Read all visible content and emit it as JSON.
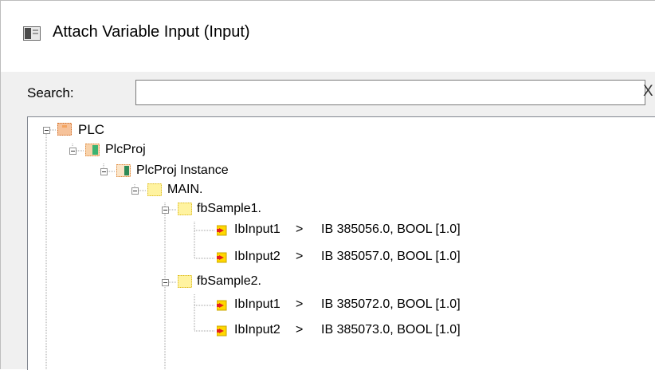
{
  "window": {
    "title": "Attach Variable Input (Input)",
    "icon": "window-app-icon"
  },
  "search": {
    "label": "Search:",
    "value": "",
    "clear_label": "X"
  },
  "tree": {
    "nodes": [
      {
        "label": "PLC",
        "icon": "plc-icon",
        "expanded": true
      },
      {
        "label": "PlcProj",
        "icon": "plc-project-icon",
        "expanded": true
      },
      {
        "label": "PlcProj Instance",
        "icon": "plc-instance-icon",
        "expanded": true
      },
      {
        "label": "MAIN.",
        "icon": "folder-icon",
        "expanded": true
      },
      {
        "label": "fbSample1.",
        "icon": "folder-icon",
        "expanded": true
      },
      {
        "label": "IbInput1",
        "link": ">",
        "address": "IB 385056.0, BOOL [1.0]",
        "icon": "input-variable-icon"
      },
      {
        "label": "IbInput2",
        "link": ">",
        "address": "IB 385057.0, BOOL [1.0]",
        "icon": "input-variable-icon"
      },
      {
        "label": "fbSample2.",
        "icon": "folder-icon",
        "expanded": true
      },
      {
        "label": "IbInput1",
        "link": ">",
        "address": "IB 385072.0, BOOL [1.0]",
        "icon": "input-variable-icon"
      },
      {
        "label": "IbInput2",
        "link": ">",
        "address": "IB 385073.0, BOOL [1.0]",
        "icon": "input-variable-icon"
      }
    ]
  }
}
